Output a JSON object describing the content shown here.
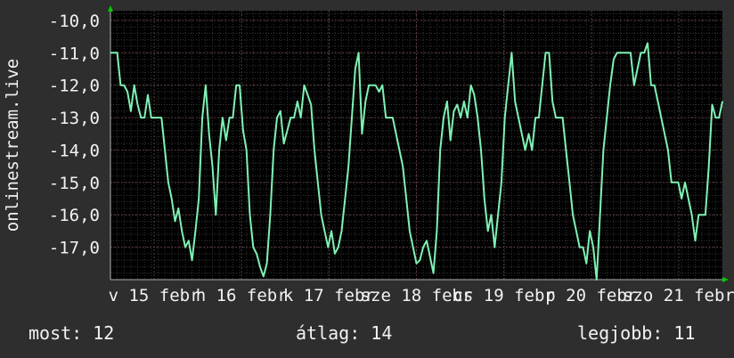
{
  "chart_data": {
    "type": "line",
    "ylabel": "onlinestream.live",
    "yticks": [
      "-10,0",
      "-11,0",
      "-12,0",
      "-13,0",
      "-14,0",
      "-15,0",
      "-16,0",
      "-17,0"
    ],
    "xticks": [
      "v 15 febr",
      "h 16 febr",
      "k 17 febr",
      "sze 18 febr",
      "cs 19 febr",
      "p 20 febr",
      "szo 21 febr"
    ],
    "ylim": [
      -18.0,
      -9.7
    ],
    "xlim": [
      0,
      180
    ],
    "grid": true,
    "series": [
      {
        "color": "#7ff2b4",
        "x": [
          0,
          2,
          3,
          4,
          5,
          6,
          7,
          8,
          9,
          10,
          11,
          12,
          13,
          14,
          15,
          16,
          17,
          18,
          19,
          20,
          21,
          22,
          23,
          24,
          25,
          26,
          27,
          28,
          29,
          30,
          31,
          32,
          33,
          34,
          35,
          36,
          37,
          38,
          39,
          40,
          41,
          42,
          43,
          44,
          45,
          46,
          47,
          48,
          49,
          50,
          51,
          52,
          53,
          54,
          55,
          56,
          57,
          58,
          59,
          60,
          61,
          62,
          63,
          64,
          65,
          66,
          67,
          68,
          69,
          70,
          71,
          72,
          73,
          74,
          75,
          76,
          77,
          78,
          79,
          80,
          81,
          82,
          83,
          84,
          85,
          86,
          87,
          88,
          89,
          90,
          91,
          92,
          93,
          94,
          95,
          96,
          97,
          98,
          99,
          100,
          101,
          102,
          103,
          104,
          105,
          106,
          107,
          108,
          109,
          110,
          111,
          112,
          113,
          114,
          115,
          116,
          117,
          118,
          119,
          120,
          121,
          122,
          123,
          124,
          125,
          126,
          127,
          128,
          129,
          130,
          131,
          132,
          133,
          134,
          135,
          136,
          137,
          138,
          139,
          140,
          141,
          142,
          143,
          144,
          145,
          146,
          147,
          148,
          149,
          150,
          151,
          152,
          153,
          154,
          155,
          156,
          157,
          158,
          159,
          160,
          161,
          162,
          163,
          164,
          165,
          166,
          167,
          168,
          169,
          170,
          171,
          172,
          173,
          174,
          175,
          176,
          177,
          178,
          179,
          180
        ],
        "y": [
          -11.0,
          -11.0,
          -12.0,
          -12.0,
          -12.2,
          -12.8,
          -12.0,
          -12.6,
          -13.0,
          -13.0,
          -12.3,
          -13.0,
          -13.0,
          -13.0,
          -13.0,
          -14.0,
          -15.0,
          -15.5,
          -16.2,
          -15.8,
          -16.5,
          -17.0,
          -16.8,
          -17.4,
          -16.5,
          -15.5,
          -13.0,
          -12.0,
          -13.5,
          -14.5,
          -16.0,
          -14.0,
          -13.0,
          -13.7,
          -13.0,
          -13.0,
          -12.0,
          -12.0,
          -13.4,
          -14.0,
          -16.0,
          -17.0,
          -17.2,
          -17.6,
          -17.9,
          -17.5,
          -16.0,
          -14.0,
          -13.0,
          -12.8,
          -13.8,
          -13.4,
          -13.0,
          -13.0,
          -12.5,
          -13.0,
          -12.0,
          -12.3,
          -12.6,
          -14.0,
          -15.0,
          -16.0,
          -16.5,
          -17.0,
          -16.5,
          -17.2,
          -17.0,
          -16.5,
          -15.5,
          -14.5,
          -13.0,
          -11.5,
          -11.0,
          -13.5,
          -12.5,
          -12.0,
          -12.0,
          -12.0,
          -12.2,
          -12.0,
          -13.0,
          -13.0,
          -13.0,
          -13.5,
          -14.0,
          -14.5,
          -15.5,
          -16.5,
          -17.0,
          -17.5,
          -17.4,
          -17.0,
          -16.8,
          -17.3,
          -17.8,
          -16.5,
          -14.0,
          -13.0,
          -12.5,
          -13.7,
          -12.8,
          -12.6,
          -13.0,
          -12.5,
          -13.0,
          -12.0,
          -12.3,
          -13.0,
          -14.0,
          -15.5,
          -16.5,
          -16.0,
          -17.0,
          -16.0,
          -15.0,
          -13.0,
          -12.0,
          -11.0,
          -12.5,
          -13.0,
          -13.5,
          -14.0,
          -13.5,
          -14.0,
          -13.0,
          -13.0,
          -12.0,
          -11.0,
          -11.0,
          -12.5,
          -13.0,
          -13.0,
          -13.0,
          -14.0,
          -15.0,
          -16.0,
          -16.5,
          -17.0,
          -17.0,
          -17.5,
          -16.5,
          -17.0,
          -18.0,
          -16.0,
          -14.0,
          -13.0,
          -12.0,
          -11.2,
          -11.0,
          -11.0,
          -11.0,
          -11.0,
          -11.0,
          -12.0,
          -11.5,
          -11.0,
          -11.0,
          -10.7,
          -12.0,
          -12.0,
          -12.5,
          -13.0,
          -13.5,
          -14.0,
          -15.0,
          -15.0,
          -15.0,
          -15.5,
          -15.0,
          -15.5,
          -16.0,
          -16.8,
          -16.0,
          -16.0,
          -16.0,
          -14.5,
          -12.6,
          -13.0,
          -13.0,
          -12.5
        ]
      }
    ]
  },
  "stats": {
    "most": "most: 12",
    "atlag": "átlag: 14",
    "legjobb": "legjobb: 11"
  }
}
